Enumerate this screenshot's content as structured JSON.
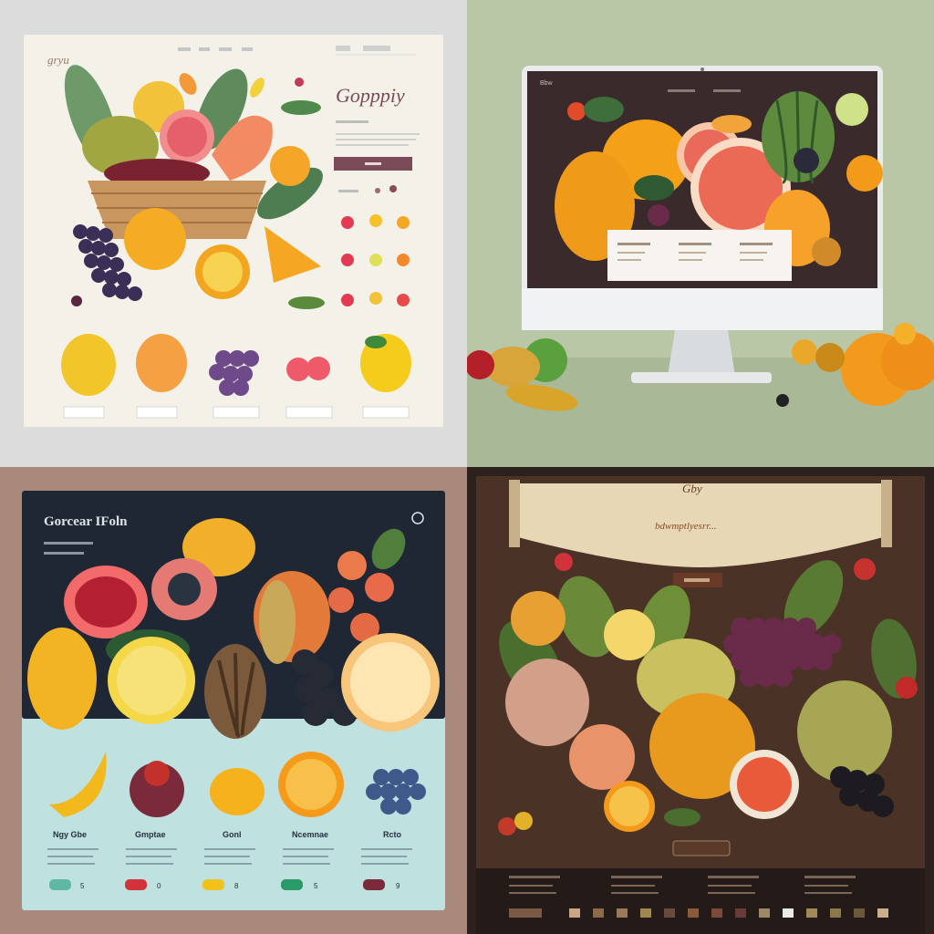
{
  "panels": {
    "top_left": {
      "logo": "gryu",
      "title": "Gopppiy",
      "nav_items": [
        "",
        "",
        "",
        ""
      ],
      "button_label": "",
      "product_labels": [
        "",
        "",
        "",
        "",
        ""
      ]
    },
    "top_right": {
      "header_logo": "Bbw",
      "card_labels": [
        "",
        "",
        ""
      ]
    },
    "bottom_left": {
      "title": "Gorcear IFoln",
      "product_names": [
        "Ngy Gbe",
        "Gmptae",
        "Gonl",
        "Ncemnae",
        "Rcto"
      ],
      "product_counts": [
        "5",
        "0",
        "8",
        "5",
        "9"
      ]
    },
    "bottom_right": {
      "logo": "Gby",
      "tagline": "bdwmptlyesrr..."
    }
  },
  "colors": {
    "cream": "#f3f1e8",
    "maroon": "#7b4b5a",
    "monitor_dark": "#3a2a2c",
    "teal_bg": "#bfe1df",
    "navy": "#1f2734",
    "brown_dark": "#2d211d"
  }
}
